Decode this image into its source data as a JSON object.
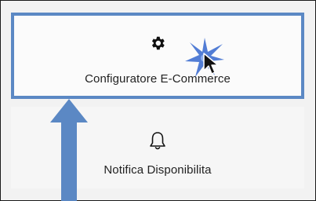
{
  "menu": {
    "items": [
      {
        "label": "Configuratore E-Commerce",
        "icon": "gear-icon",
        "selected": true
      },
      {
        "label": "Notifica Disponibilita",
        "icon": "bell-icon",
        "selected": false
      }
    ]
  },
  "annotation": {
    "arrow_color": "#5b88c4",
    "highlight_color": "#5b88c4",
    "click_burst_color": "#3f6fd0"
  }
}
